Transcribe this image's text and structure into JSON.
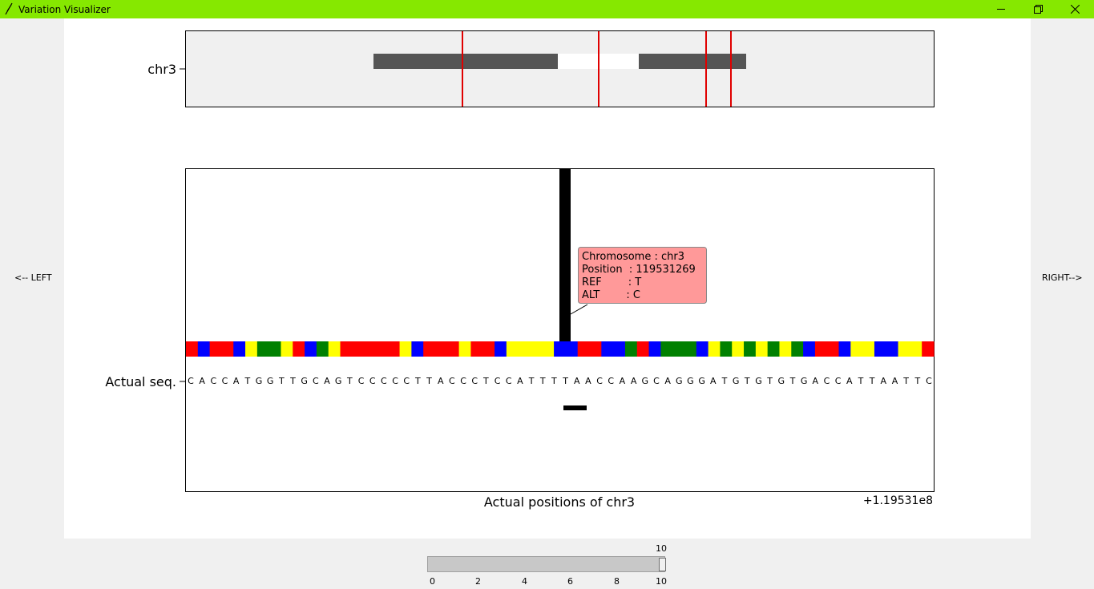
{
  "window": {
    "title": "Variation Visualizer"
  },
  "nav": {
    "left_label": "<-- LEFT",
    "right_label": "RIGHT-->"
  },
  "overview": {
    "chromosome_label": "chr3",
    "variant_line_color": "#e00000",
    "ideogram_segments": [
      {
        "shade": "dark"
      },
      {
        "shade": "light"
      },
      {
        "shade": "dark"
      }
    ]
  },
  "detail": {
    "row_label": "Actual seq.",
    "x_axis_label": "Actual positions of chr3",
    "offset_text": "+1.19531e8",
    "base_colors": {
      "A": "#ff0000",
      "C": "#ffff00",
      "G": "#008000",
      "T": "#0000ff"
    },
    "sequence": [
      "C",
      "A",
      "C",
      "C",
      "A",
      "T",
      "G",
      "G",
      "T",
      "T",
      "G",
      "C",
      "A",
      "G",
      "T",
      "C",
      "C",
      "C",
      "C",
      "C",
      "T",
      "T",
      "A",
      "C",
      "C",
      "C",
      "T",
      "C",
      "C",
      "A",
      "T",
      "T",
      "T",
      "T",
      "A",
      "A",
      "C",
      "C",
      "A",
      "A",
      "G",
      "C",
      "A",
      "G",
      "G",
      "G",
      "A",
      "T",
      "G",
      "T",
      "G",
      "T",
      "G",
      "T",
      "G",
      "A",
      "C",
      "C",
      "A",
      "T",
      "T",
      "A",
      "A",
      "T",
      "T",
      "C"
    ],
    "color_bar": [
      "A",
      "T",
      "A",
      "A",
      "T",
      "C",
      "G",
      "G",
      "C",
      "A",
      "T",
      "G",
      "C",
      "A",
      "A",
      "A",
      "A",
      "A",
      "C",
      "T",
      "A",
      "A",
      "A",
      "C",
      "A",
      "A",
      "T",
      "C",
      "C",
      "C",
      "C",
      "T",
      "T",
      "A",
      "A",
      "T",
      "T",
      "G",
      "A",
      "T",
      "G",
      "G",
      "G",
      "T",
      "C",
      "G",
      "C",
      "G",
      "C",
      "G",
      "C",
      "G",
      "T",
      "A",
      "A",
      "T",
      "C",
      "C",
      "T",
      "T",
      "C",
      "C",
      "A"
    ],
    "tooltip": {
      "lines": [
        "Chromosome : chr3",
        "Position  : 119531269",
        "REF        : T",
        "ALT        : C"
      ],
      "background": "#ff9999"
    }
  },
  "slider": {
    "value": 10,
    "min": 0,
    "max": 10,
    "ticks": [
      "0",
      "2",
      "4",
      "6",
      "8",
      "10"
    ],
    "value_label": "10"
  }
}
